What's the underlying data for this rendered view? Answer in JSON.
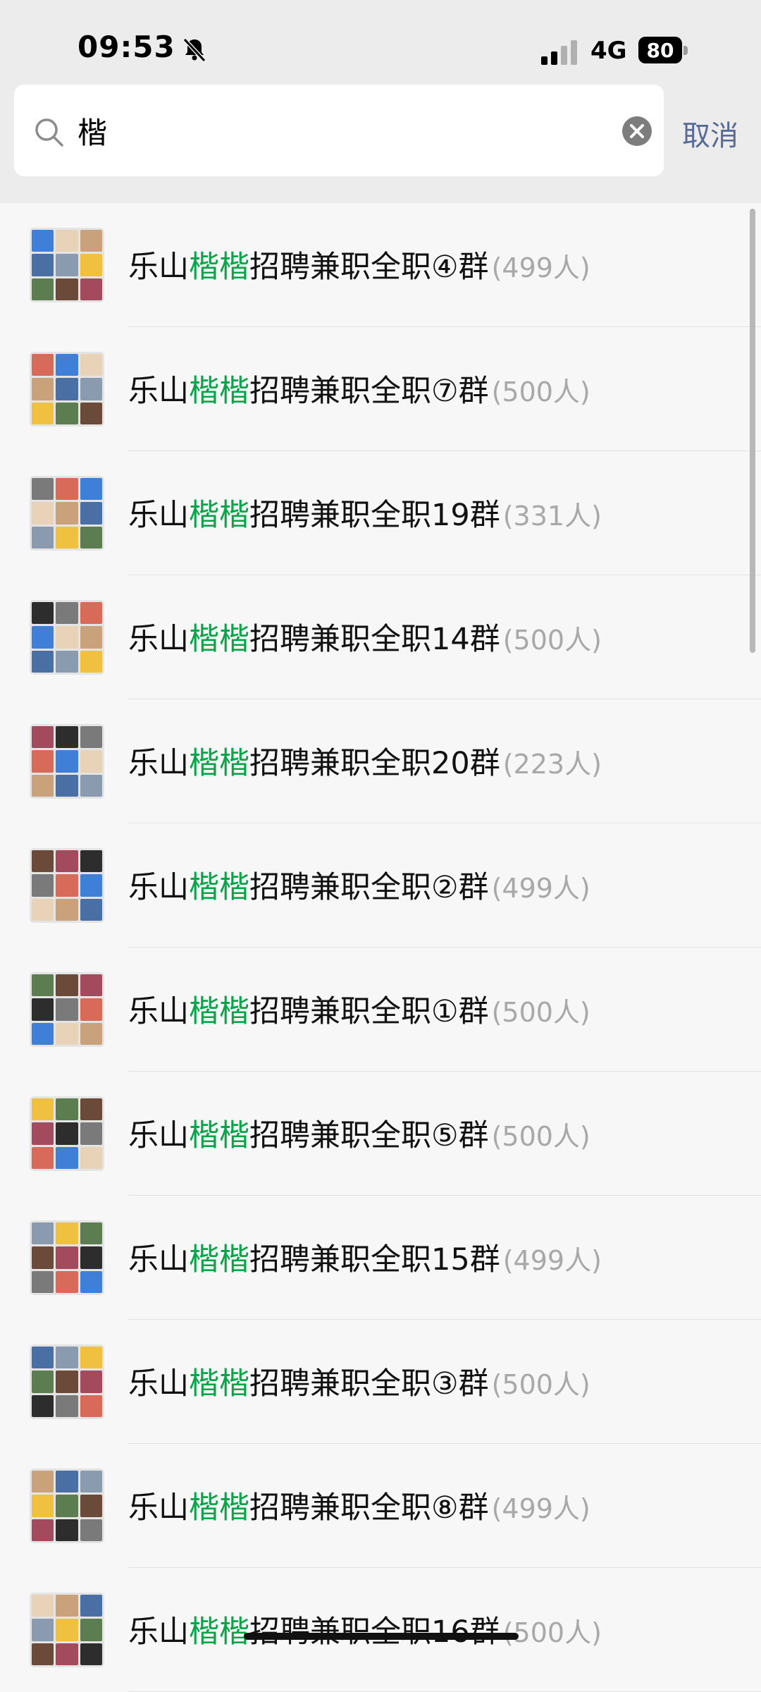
{
  "status_bar": {
    "time": "09:53",
    "network": "4G",
    "battery": "80"
  },
  "search": {
    "query": "楷",
    "cancel_label": "取消"
  },
  "results": [
    {
      "prefix": "乐山",
      "highlight": "楷楷",
      "suffix": "招聘兼职全职④群",
      "count": "(499人)"
    },
    {
      "prefix": "乐山",
      "highlight": "楷楷",
      "suffix": "招聘兼职全职⑦群",
      "count": "(500人)"
    },
    {
      "prefix": "乐山",
      "highlight": "楷楷",
      "suffix": "招聘兼职全职19群",
      "count": "(331人)"
    },
    {
      "prefix": "乐山",
      "highlight": "楷楷",
      "suffix": "招聘兼职全职14群",
      "count": "(500人)"
    },
    {
      "prefix": "乐山",
      "highlight": "楷楷",
      "suffix": "招聘兼职全职20群",
      "count": "(223人)"
    },
    {
      "prefix": "乐山",
      "highlight": "楷楷",
      "suffix": "招聘兼职全职②群",
      "count": "(499人)"
    },
    {
      "prefix": "乐山",
      "highlight": "楷楷",
      "suffix": "招聘兼职全职①群",
      "count": "(500人)"
    },
    {
      "prefix": "乐山",
      "highlight": "楷楷",
      "suffix": "招聘兼职全职⑤群",
      "count": "(500人)"
    },
    {
      "prefix": "乐山",
      "highlight": "楷楷",
      "suffix": "招聘兼职全职15群",
      "count": "(499人)"
    },
    {
      "prefix": "乐山",
      "highlight": "楷楷",
      "suffix": "招聘兼职全职③群",
      "count": "(500人)"
    },
    {
      "prefix": "乐山",
      "highlight": "楷楷",
      "suffix": "招聘兼职全职⑧群",
      "count": "(499人)"
    },
    {
      "prefix": "乐山",
      "highlight": "楷楷",
      "suffix": "招聘兼职全职16群",
      "count": "(500人)"
    }
  ],
  "colors": {
    "highlight": "#07a449",
    "link": "#576b95",
    "avatar_palette": [
      "#3f7fd8",
      "#6b4a3a",
      "#c9a27c",
      "#2d2d2d",
      "#8a9bb0",
      "#d86a5a",
      "#5b7d4f",
      "#e8d3b8",
      "#a34a5e",
      "#4a6fa5",
      "#7a7a7a",
      "#f0c040"
    ]
  }
}
